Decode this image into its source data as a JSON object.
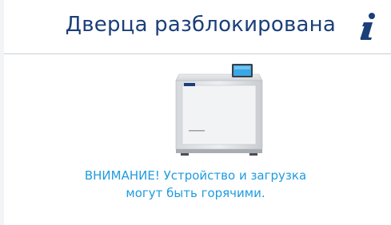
{
  "header": {
    "title": "Дверца разблокирована",
    "info_icon": "info-icon"
  },
  "device_image": {
    "brand_label": "MELAG",
    "description_icon": "autoclave-device"
  },
  "message": {
    "line1": "ВНИМАНИЕ! Устройство и загрузка",
    "line2": "могут быть горячими."
  },
  "colors": {
    "title": "#1b3f7a",
    "warning": "#1e9be0",
    "info_icon": "#1b3f7a"
  }
}
